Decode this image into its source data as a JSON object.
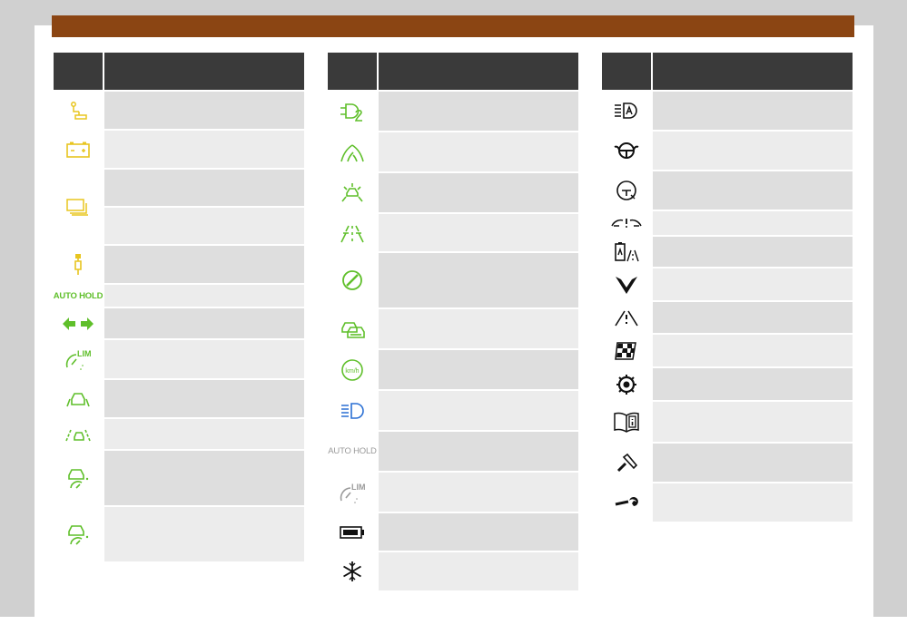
{
  "document": {
    "header_bar_color": "#8b4513",
    "table_header_color": "#3a3a3a",
    "icon_colors": {
      "yellow": "#e8c51f",
      "green": "#5fbf2a",
      "blue": "#2a6fd4",
      "black": "#111111",
      "gray": "#9a9a9a"
    }
  },
  "tables": {
    "left": {
      "rows": [
        {
          "icon": "trailer-hitch-icon",
          "color": "yellow"
        },
        {
          "icon": "battery-icon",
          "color": "yellow"
        },
        {
          "icon": "battery-stack-icon",
          "color": "yellow",
          "split": true
        },
        {
          "icon": "glow-plug-icon",
          "color": "yellow"
        },
        {
          "icon": "auto-hold-text-icon",
          "color": "green",
          "text": "AUTO HOLD"
        },
        {
          "icon": "turn-signal-arrows-icon",
          "color": "green"
        },
        {
          "icon": "speed-limiter-icon",
          "color": "green",
          "text": "LIM"
        },
        {
          "icon": "car-lane-icon",
          "color": "green"
        },
        {
          "icon": "lane-assist-icon",
          "color": "green"
        },
        {
          "icon": "car-speedometer-icon",
          "color": "green"
        },
        {
          "icon": "car-speedometer-icon-2",
          "color": "green"
        }
      ]
    },
    "middle": {
      "rows": [
        {
          "icon": "plug-charge-icon",
          "color": "green"
        },
        {
          "icon": "lane-road-icon",
          "color": "green"
        },
        {
          "icon": "car-sensor-front-icon",
          "color": "green"
        },
        {
          "icon": "lane-split-icon",
          "color": "green"
        },
        {
          "icon": "no-sign-icon",
          "color": "green"
        },
        {
          "icon": "car-distance-icon",
          "color": "green"
        },
        {
          "icon": "kmh-circle-icon",
          "color": "green",
          "text": "km/h"
        },
        {
          "icon": "high-beam-icon",
          "color": "blue"
        },
        {
          "icon": "auto-hold-gray-icon",
          "color": "gray",
          "text": "AUTO HOLD"
        },
        {
          "icon": "speed-limiter-gray-icon",
          "color": "gray",
          "text": "LIM"
        },
        {
          "icon": "battery-level-icon",
          "color": "black"
        },
        {
          "icon": "snowflake-icon",
          "color": "black"
        }
      ]
    },
    "right": {
      "rows": [
        {
          "icon": "auto-light-icon",
          "color": "black"
        },
        {
          "icon": "steering-hands-icon",
          "color": "black"
        },
        {
          "icon": "driver-alert-icon",
          "color": "black"
        },
        {
          "icon": "wiper-warning-icon",
          "color": "black"
        },
        {
          "icon": "battery-road-icon",
          "color": "black"
        },
        {
          "icon": "brand-logo-icon",
          "color": "black"
        },
        {
          "icon": "road-warning-icon",
          "color": "black"
        },
        {
          "icon": "checkered-flag-icon",
          "color": "black"
        },
        {
          "icon": "gear-service-icon",
          "color": "black"
        },
        {
          "icon": "manual-info-icon",
          "color": "black"
        },
        {
          "icon": "tool-icon",
          "color": "black"
        },
        {
          "icon": "wrench-icon",
          "color": "black"
        }
      ]
    }
  },
  "text_icons": {
    "auto_hold": "AUTO HOLD",
    "lim": "LIM",
    "kmh": "km/h"
  }
}
